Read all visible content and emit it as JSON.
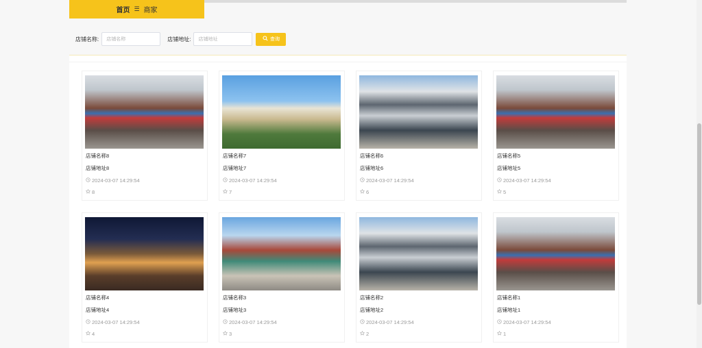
{
  "breadcrumb": {
    "home": "首页",
    "separator": "☰",
    "current": "商家"
  },
  "search": {
    "name_label": "店铺名称:",
    "name_placeholder": "店铺名称",
    "addr_label": "店铺地址:",
    "addr_placeholder": "店铺地址",
    "button_label": "查询"
  },
  "icons": {
    "search": "search-icon",
    "clock": "clock-icon",
    "star": "star-icon"
  },
  "colors": {
    "accent": "#f6c31b"
  },
  "shops": [
    {
      "name": "店铺名称8",
      "address": "店铺地址8",
      "time": "2024-03-07 14:29:54",
      "count": "8"
    },
    {
      "name": "店铺名称7",
      "address": "店铺地址7",
      "time": "2024-03-07 14:29:54",
      "count": "7"
    },
    {
      "name": "店铺名称6",
      "address": "店铺地址6",
      "time": "2024-03-07 14:29:54",
      "count": "6"
    },
    {
      "name": "店铺名称5",
      "address": "店铺地址5",
      "time": "2024-03-07 14:29:54",
      "count": "5"
    },
    {
      "name": "店铺名称4",
      "address": "店铺地址4",
      "time": "2024-03-07 14:29:54",
      "count": "4"
    },
    {
      "name": "店铺名称3",
      "address": "店铺地址3",
      "time": "2024-03-07 14:29:54",
      "count": "3"
    },
    {
      "name": "店铺名称2",
      "address": "店铺地址2",
      "time": "2024-03-07 14:29:54",
      "count": "2"
    },
    {
      "name": "店铺名称1",
      "address": "店铺地址1",
      "time": "2024-03-07 14:29:54",
      "count": "1"
    }
  ]
}
